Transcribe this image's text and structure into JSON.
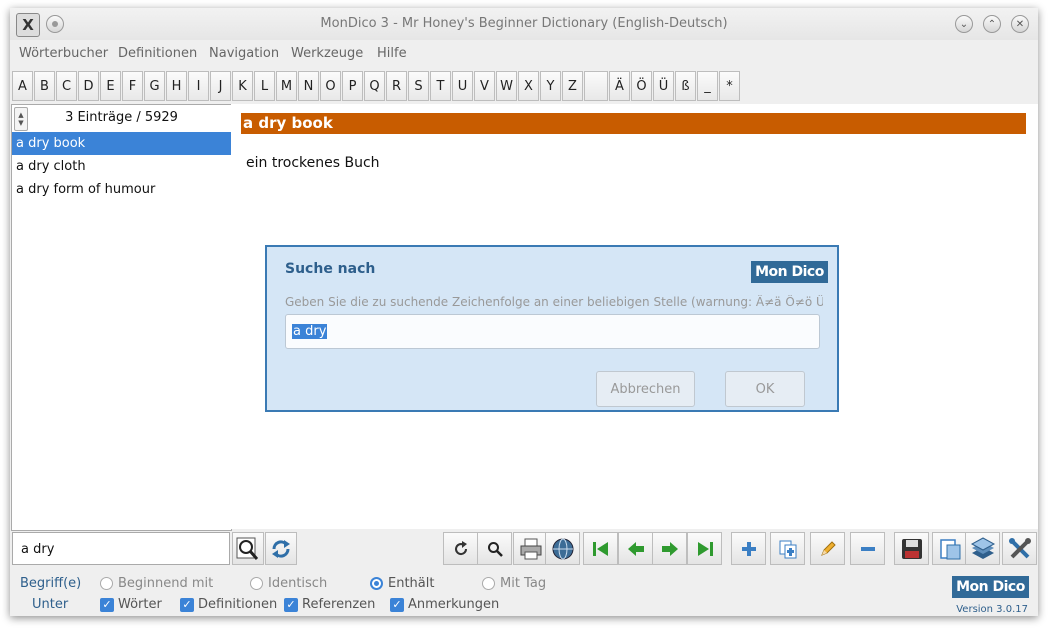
{
  "window": {
    "title": "MonDico 3 - Mr Honey's Beginner Dictionary (English-Deutsch)",
    "app_icon": "X"
  },
  "menu": [
    "Wörterbucher",
    "Definitionen",
    "Navigation",
    "Werkzeuge",
    "Hilfe"
  ],
  "alphabet": [
    "A",
    "B",
    "C",
    "D",
    "E",
    "F",
    "G",
    "H",
    "I",
    "J",
    "K",
    "L",
    "M",
    "N",
    "O",
    "P",
    "Q",
    "R",
    "S",
    "T",
    "U",
    "V",
    "W",
    "X",
    "Y",
    "Z",
    "",
    "Ä",
    "Ö",
    "Ü",
    "ß",
    "_",
    "*"
  ],
  "list": {
    "count_label": "3 Einträge / 5929",
    "entries": [
      "a dry book",
      "a dry cloth",
      "a dry form of humour"
    ],
    "selected_index": 0
  },
  "definition": {
    "headword": "a dry book",
    "translation": "ein trockenes Buch"
  },
  "dialog": {
    "title": "Suche nach",
    "logo": "Mon Dico",
    "hint": "Geben Sie die zu suchende Zeichenfolge an einer beliebigen Stelle (warnung: Ä≠ä Ö≠ö Ü≠ü)",
    "input_value": "a dry",
    "cancel_label": "Abbrechen",
    "ok_label": "OK"
  },
  "search": {
    "value": "a dry"
  },
  "options": {
    "begriff_label": "Begriff(e)",
    "unter_label": "Unter",
    "radios": [
      {
        "label": "Beginnend mit",
        "checked": false
      },
      {
        "label": "Identisch",
        "checked": false
      },
      {
        "label": "Enthält",
        "checked": true
      },
      {
        "label": "Mit Tag",
        "checked": false
      }
    ],
    "checkboxes": [
      {
        "label": "Wörter",
        "checked": true
      },
      {
        "label": "Definitionen",
        "checked": true
      },
      {
        "label": "Referenzen",
        "checked": true
      },
      {
        "label": "Anmerkungen",
        "checked": true
      }
    ],
    "logo": "Mon Dico",
    "version": "Version 3.0.17"
  },
  "colors": {
    "accent": "#3b83d7",
    "headword_bar": "#c85c00",
    "dialog_bg": "#d5e6f6",
    "brand": "#316a98",
    "nav_green": "#2f9a2f"
  }
}
